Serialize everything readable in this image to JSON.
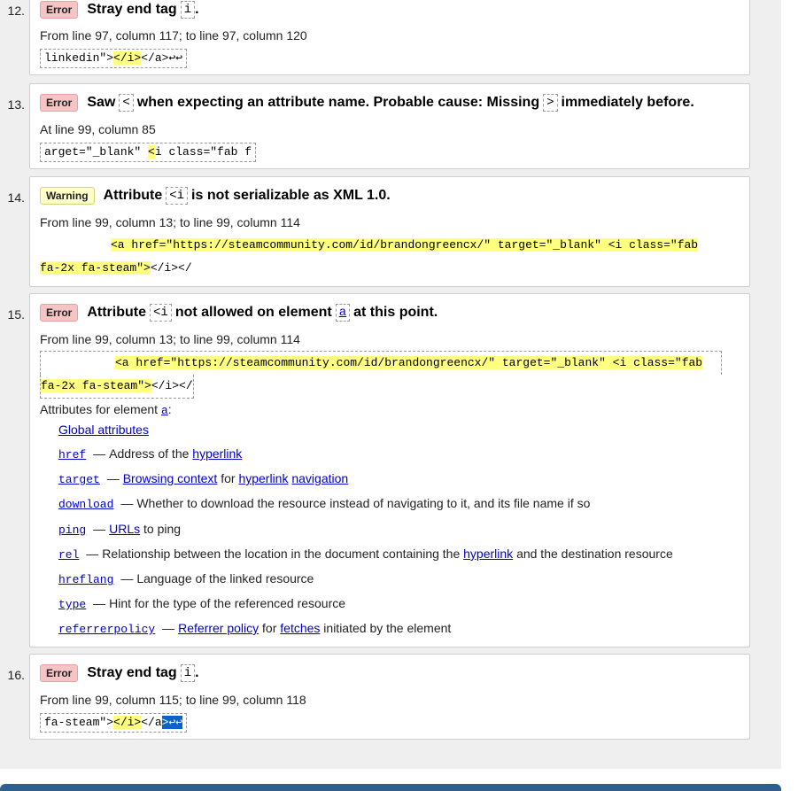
{
  "messages": {
    "m12": {
      "num": "12.",
      "type": "Error",
      "title_pre": "Stray end tag",
      "code": "i",
      "title_post": ".",
      "location": "From line 97, column 117; to line 97, column 120",
      "extract_pre": "linkedin\">",
      "extract_hl": "</i>",
      "extract_post": "</a>",
      "extract_mark": "↩↩"
    },
    "m13": {
      "num": "13.",
      "type": "Error",
      "title_a": "Saw",
      "code_a": "<",
      "title_b": "when expecting an attribute name. Probable cause: Missing",
      "code_b": ">",
      "title_c": "immediately before.",
      "location": "At line 99, column 85",
      "extract_pre": "arget=\"_blank\" ",
      "extract_hl": "<",
      "extract_post": "i class=\"fab f"
    },
    "m14": {
      "num": "14.",
      "type": "Warning",
      "title_a": "Attribute",
      "code_a": "<i",
      "title_b": "is not serializable as XML 1.0.",
      "location": "From line 99, column 13; to line 99, column 114",
      "line1_hl": "<a href=\"https://steamcommunity.com/id/brandongreencx/\" target=\"_blank\" <i class=\"fab",
      "line2_hl": "fa-2x fa-steam\">",
      "line2_post": "</i></"
    },
    "m15": {
      "num": "15.",
      "type": "Error",
      "title_a": "Attribute",
      "code_a": "<i",
      "title_b": "not allowed on element",
      "code_b": "a",
      "title_c": "at this point.",
      "location": "From line 99, column 13; to line 99, column 114",
      "line1_hl": "<a href=\"https://steamcommunity.com/id/brandongreencx/\" target=\"_blank\" <i class=\"fab",
      "line2_hl": "fa-2x fa-steam\">",
      "line2_post": "</i></",
      "attrs_label": "Attributes for element",
      "attrs_element": "a",
      "attrs_colon": ":",
      "global_attributes": "Global attributes",
      "attributes": [
        {
          "name": "href",
          "desc_a": "Address of the",
          "link1": "hyperlink"
        },
        {
          "name": "target",
          "link1": "Browsing context",
          "desc_b": "for",
          "link2": "hyperlink",
          "link3": "navigation"
        },
        {
          "name": "download",
          "desc_a": "Whether to download the resource instead of navigating to it, and its file name if so"
        },
        {
          "name": "ping",
          "link1": "URLs",
          "desc_b": "to ping"
        },
        {
          "name": "rel",
          "desc_a": "Relationship between the location in the document containing the",
          "link1": "hyperlink",
          "desc_c": "and the destination resource"
        },
        {
          "name": "hreflang",
          "desc_a": "Language of the linked resource"
        },
        {
          "name": "type",
          "desc_a": "Hint for the type of the referenced resource"
        },
        {
          "name": "referrerpolicy",
          "link1": "Referrer policy",
          "desc_b": "for",
          "link2": "fetches",
          "desc_c": "initiated by the element"
        }
      ],
      "dash": "—"
    },
    "m16": {
      "num": "16.",
      "type": "Error",
      "title_pre": "Stray end tag",
      "code": "i",
      "title_post": ".",
      "location": "From line 99, column 115; to line 99, column 118",
      "extract_pre": "fa-steam\">",
      "extract_hl": "</i>",
      "extract_post": "</a",
      "extract_sel": ">↩↩"
    }
  }
}
